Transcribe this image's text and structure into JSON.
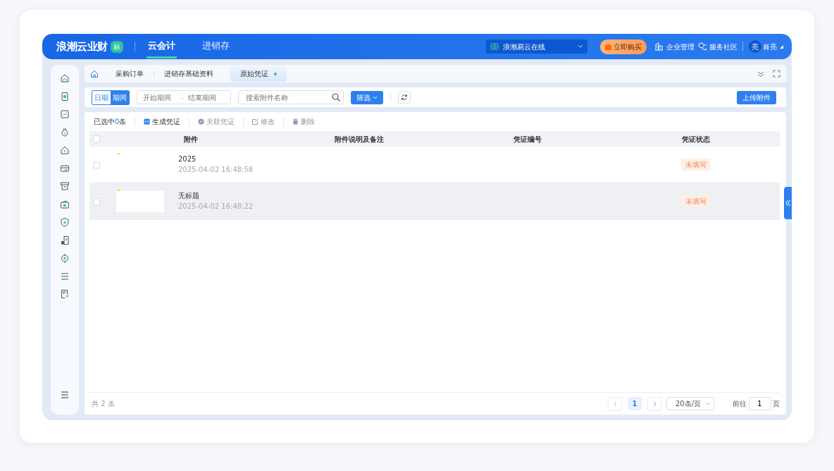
{
  "header": {
    "brand": "浪潮云业财",
    "edition_badge": "标",
    "nav": [
      {
        "label": "云会计",
        "selected": true
      },
      {
        "label": "进销存",
        "selected": false
      }
    ],
    "org_select": {
      "value": "浪潮易云在线"
    },
    "buy_button": "立即购买",
    "links": [
      "企业管理",
      "服务社区"
    ],
    "user": {
      "avatar": "亮",
      "name": "肖亮"
    }
  },
  "tabs": [
    {
      "label": "采购订单",
      "selected": false
    },
    {
      "label": "进销存基础资料",
      "selected": false
    },
    {
      "label": "原始凭证",
      "selected": true
    }
  ],
  "filter": {
    "modes": [
      {
        "label": "日期",
        "selected": false
      },
      {
        "label": "期间",
        "selected": true
      }
    ],
    "start_placeholder": "开始期间",
    "separator": "-",
    "end_placeholder": "结束期间",
    "search_placeholder": "搜索附件名称",
    "filter_button": "筛选",
    "upload_button": "上传附件"
  },
  "actions": {
    "selected_prefix": "已选中",
    "selected_count": "0",
    "selected_suffix": "条",
    "buttons": [
      {
        "label": "生成凭证",
        "disabled": false
      },
      {
        "label": "关联凭证",
        "disabled": true
      },
      {
        "label": "修改",
        "disabled": true
      },
      {
        "label": "删除",
        "disabled": true
      }
    ]
  },
  "table": {
    "all_checked": false,
    "columns": [
      "附件",
      "附件说明及备注",
      "凭证编号",
      "凭证状态"
    ],
    "rows": [
      {
        "checked": false,
        "name": "2025",
        "time": "2025-04-02 16:48:58",
        "status": "未填写",
        "selected": false
      },
      {
        "checked": false,
        "name": "无标题",
        "time": "2025-04-02 16:48:22",
        "status": "未填写",
        "selected": true
      }
    ]
  },
  "pagination": {
    "total": "共 2 条",
    "pages": [
      {
        "label": "1",
        "selected": true
      }
    ],
    "page_size": "20条/页",
    "goto_label": "前往",
    "goto_value": "1",
    "goto_suffix": "页"
  }
}
